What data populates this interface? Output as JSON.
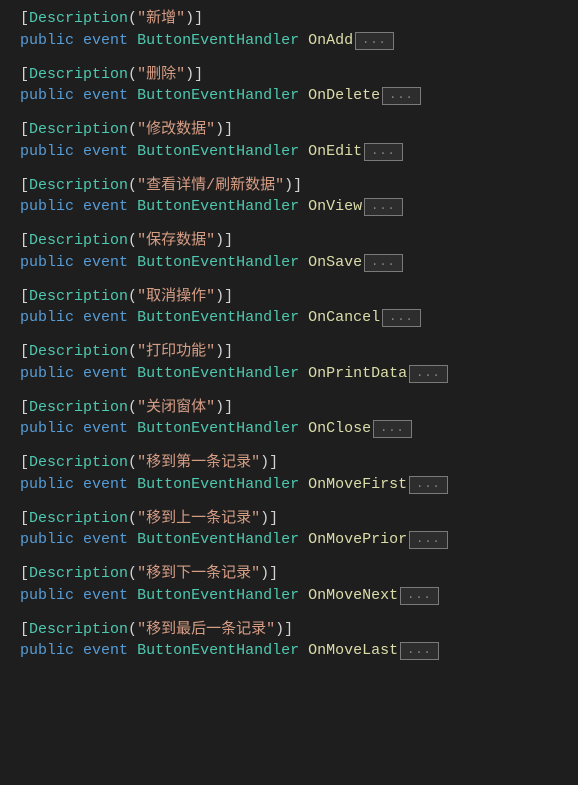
{
  "entries": [
    {
      "desc": "新增",
      "name": "OnAdd"
    },
    {
      "desc": "删除",
      "name": "OnDelete"
    },
    {
      "desc": "修改数据",
      "name": "OnEdit"
    },
    {
      "desc": "查看详情/刷新数据",
      "name": "OnView"
    },
    {
      "desc": "保存数据",
      "name": "OnSave"
    },
    {
      "desc": "取消操作",
      "name": "OnCancel"
    },
    {
      "desc": "打印功能",
      "name": "OnPrintData"
    },
    {
      "desc": "关闭窗体",
      "name": "OnClose"
    },
    {
      "desc": "移到第一条记录",
      "name": "OnMoveFirst"
    },
    {
      "desc": "移到上一条记录",
      "name": "OnMovePrior"
    },
    {
      "desc": "移到下一条记录",
      "name": "OnMoveNext"
    },
    {
      "desc": "移到最后一条记录",
      "name": "OnMoveLast"
    }
  ],
  "tokens": {
    "description": "Description",
    "public": "public",
    "event": "event",
    "handler": "ButtonEventHandler",
    "fold": "..."
  }
}
